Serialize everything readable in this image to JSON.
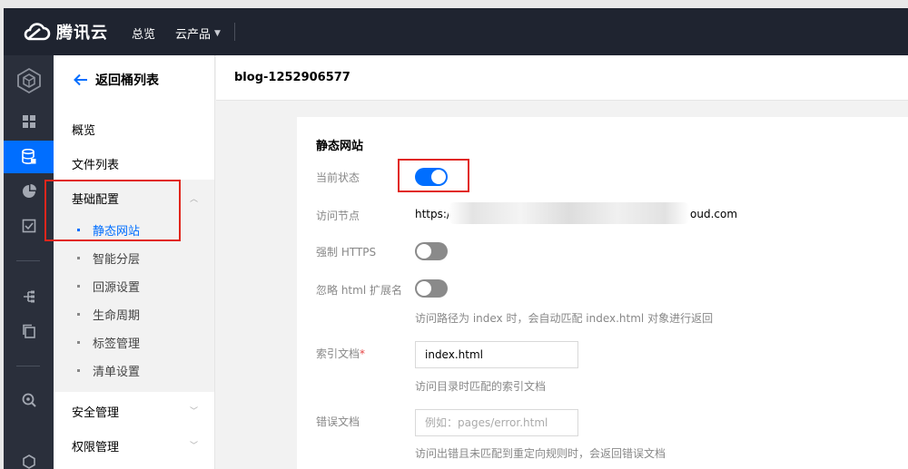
{
  "topbar": {
    "brand": "腾讯云",
    "nav_overview": "总览",
    "nav_products": "云产品"
  },
  "sidebar": {
    "back_label": "返回桶列表",
    "items": [
      {
        "label": "概览"
      },
      {
        "label": "文件列表"
      }
    ],
    "group_basic": "基础配置",
    "sub_items": [
      {
        "label": "静态网站"
      },
      {
        "label": "智能分层"
      },
      {
        "label": "回源设置"
      },
      {
        "label": "生命周期"
      },
      {
        "label": "标签管理"
      },
      {
        "label": "清单设置"
      }
    ],
    "group_security": "安全管理",
    "group_permission": "权限管理"
  },
  "header": {
    "bucket_name": "blog-1252906577"
  },
  "panel": {
    "title": "静态网站",
    "status_label": "当前状态",
    "status_on": true,
    "endpoint_label": "访问节点",
    "endpoint_prefix": "https://b",
    "endpoint_suffix": "oud.com",
    "https_label": "强制 HTTPS",
    "https_on": false,
    "ignore_ext_label": "忽略 html 扩展名",
    "ignore_ext_on": false,
    "ignore_ext_hint": "访问路径为 index 时，会自动匹配 index.html 对象进行返回",
    "index_label": "索引文档",
    "index_required": "*",
    "index_value": "index.html",
    "index_hint": "访问目录时匹配的索引文档",
    "error_label": "错误文档",
    "error_placeholder": "例如：pages/error.html",
    "error_hint": "访问出错且未匹配到重定向规则时，会返回错误文档"
  },
  "colors": {
    "accent": "#006eff",
    "topbar_bg": "#1f2430",
    "iconbar_bg": "#2a2f3b",
    "highlight_box": "#e1261c"
  }
}
